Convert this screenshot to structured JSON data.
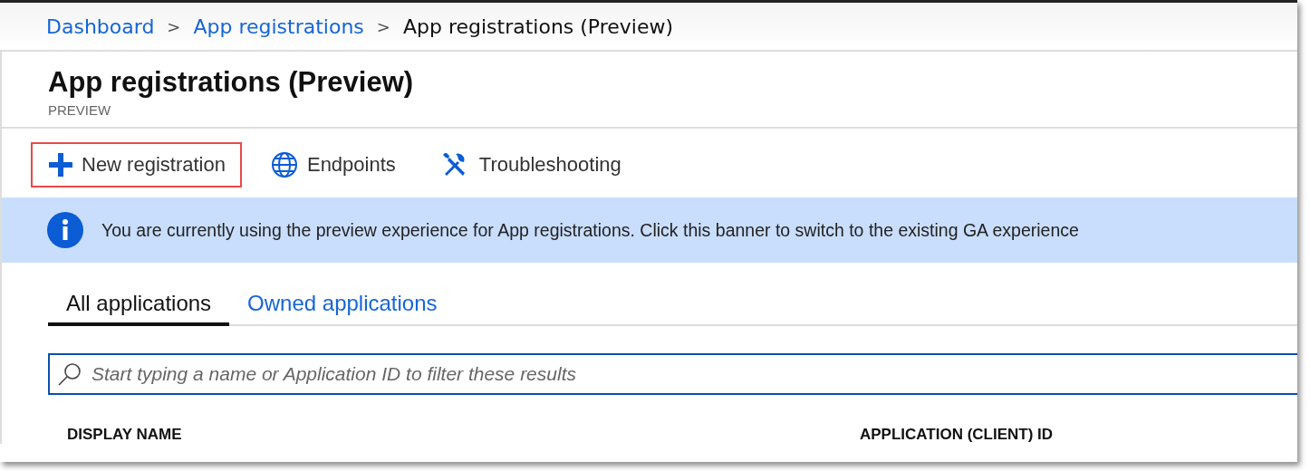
{
  "breadcrumb": [
    {
      "label": "Dashboard",
      "link": true
    },
    {
      "label": "App registrations",
      "link": true
    },
    {
      "label": "App registrations (Preview)",
      "link": false
    }
  ],
  "breadcrumb_separator": ">",
  "page": {
    "title": "App registrations (Preview)",
    "subtitle": "PREVIEW"
  },
  "toolbar": [
    {
      "label": "New registration",
      "kind": "plus",
      "highlighted": true
    },
    {
      "label": "Endpoints",
      "kind": "globe",
      "highlighted": false
    },
    {
      "label": "Troubleshooting",
      "kind": "tools",
      "highlighted": false
    }
  ],
  "banner": {
    "text": "You are currently using the preview experience for App registrations. Click this banner to switch to the existing GA experience"
  },
  "tabs": [
    {
      "label": "All applications",
      "selected": true
    },
    {
      "label": "Owned applications",
      "selected": false
    }
  ],
  "search": {
    "placeholder": "Start typing a name or Application ID to filter these results"
  },
  "table": {
    "columns": [
      "DISPLAY NAME",
      "APPLICATION (CLIENT) ID"
    ]
  }
}
